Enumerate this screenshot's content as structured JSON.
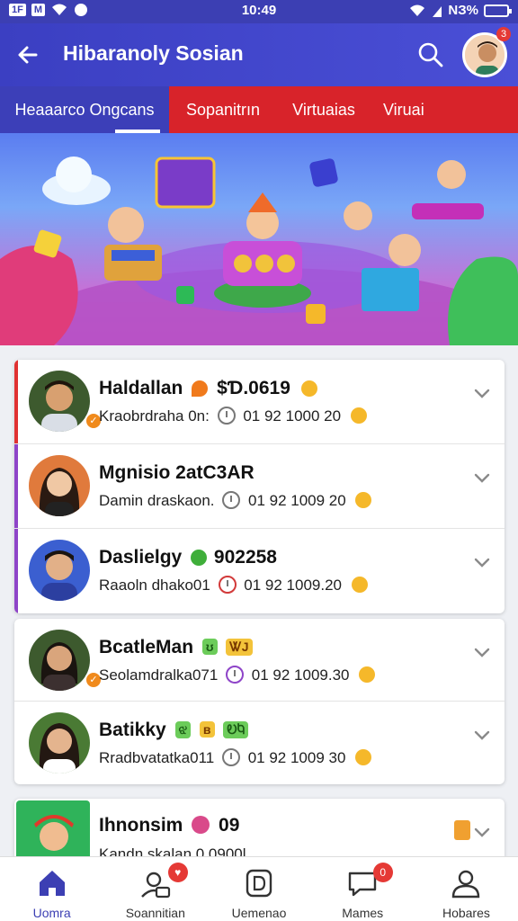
{
  "status_bar": {
    "left_1": "1F",
    "left_2": "M",
    "time": "10:49",
    "battery": "NЗ%"
  },
  "app_bar": {
    "title": "Hibaranoly Sosian",
    "avatar_badge": "3"
  },
  "tabs": [
    {
      "label": "Heaaarco Ongcans"
    },
    {
      "label": "Sopanitrın"
    },
    {
      "label": "Virtuaias"
    },
    {
      "label": "Viruai"
    }
  ],
  "lists": [
    {
      "rows": [
        {
          "name": "Haldallan",
          "amount": "$Ɗ.0619",
          "sub_label": "Kraobrdraha 0n:",
          "sub_value": "01 92 1000 20",
          "stripe": "#e03131",
          "verified": true,
          "avatar_bg": "#3d5a2e"
        },
        {
          "name": "Mgnisio 2atC3AR",
          "amount": "",
          "sub_label": "Damin draskaon.",
          "sub_value": "01 92 1009 20",
          "stripe": "#8e44c8",
          "verified": false,
          "avatar_bg": "#e07a3c"
        },
        {
          "name": "Daslielgy",
          "amount": "902258",
          "sub_label": "Raaoln dhako01",
          "sub_value": "01 92 1009.20",
          "stripe": "#8e44c8",
          "verified": false,
          "avatar_bg": "#3b5fd0"
        }
      ]
    },
    {
      "rows": [
        {
          "name": "BcatleMan",
          "amount": "",
          "sub_label": "Seolamdralka071",
          "sub_value": "01 92 1009.30",
          "stripe": "",
          "verified": true,
          "avatar_bg": "#3d5a2e"
        },
        {
          "name": "Batikky",
          "amount": "",
          "sub_label": "Rradbvatatka011",
          "sub_value": "01 92 1009 30",
          "stripe": "",
          "verified": false,
          "avatar_bg": "#4a7a34"
        }
      ]
    },
    {
      "rows": [
        {
          "name": "Ihnonsim",
          "amount": "09",
          "sub_label": "Kandn skalan 0.0900l",
          "sub_value": "",
          "stripe": "",
          "verified": false,
          "avatar_bg": "#2fb35a"
        }
      ]
    }
  ],
  "bottom_nav": [
    {
      "label": "Uomra",
      "icon": "home-icon",
      "badge": ""
    },
    {
      "label": "Soannitian",
      "icon": "profile-card-icon",
      "badge": "♥"
    },
    {
      "label": "Uemenao",
      "icon": "d-badge-icon",
      "badge": ""
    },
    {
      "label": "Mames",
      "icon": "chat-icon",
      "badge": "0"
    },
    {
      "label": "Hobares",
      "icon": "person-icon",
      "badge": ""
    }
  ],
  "colors": {
    "primary": "#3c3fb3",
    "tab_red": "#d8232a",
    "badge_red": "#e53935"
  }
}
